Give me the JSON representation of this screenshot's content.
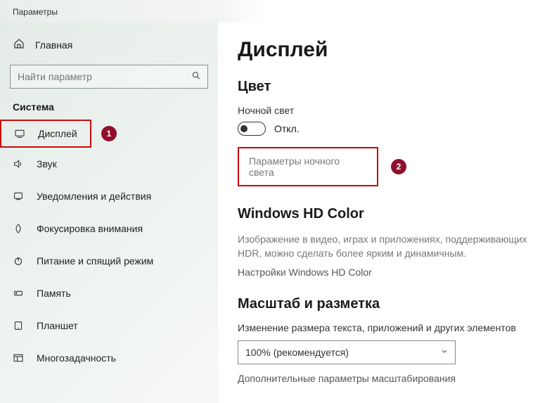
{
  "window": {
    "title": "Параметры"
  },
  "sidebar": {
    "home": "Главная",
    "search_placeholder": "Найти параметр",
    "section": "Система",
    "items": [
      {
        "label": "Дисплей"
      },
      {
        "label": "Звук"
      },
      {
        "label": "Уведомления и действия"
      },
      {
        "label": "Фокусировка внимания"
      },
      {
        "label": "Питание и спящий режим"
      },
      {
        "label": "Память"
      },
      {
        "label": "Планшет"
      },
      {
        "label": "Многозадачность"
      }
    ]
  },
  "callouts": {
    "one": "1",
    "two": "2"
  },
  "main": {
    "title": "Дисплей",
    "color": {
      "heading": "Цвет",
      "night_label": "Ночной свет",
      "toggle_state": "Откл.",
      "night_settings": "Параметры ночного света"
    },
    "hd": {
      "heading": "Windows HD Color",
      "desc": "Изображение в видео, играх и приложениях, поддерживающих HDR, можно сделать более ярким и динамичным.",
      "link": "Настройки Windows HD Color"
    },
    "scale": {
      "heading": "Масштаб и разметка",
      "label": "Изменение размера текста, приложений и других элементов",
      "select_value": "100% (рекомендуется)",
      "advanced": "Дополнительные параметры масштабирования"
    }
  }
}
